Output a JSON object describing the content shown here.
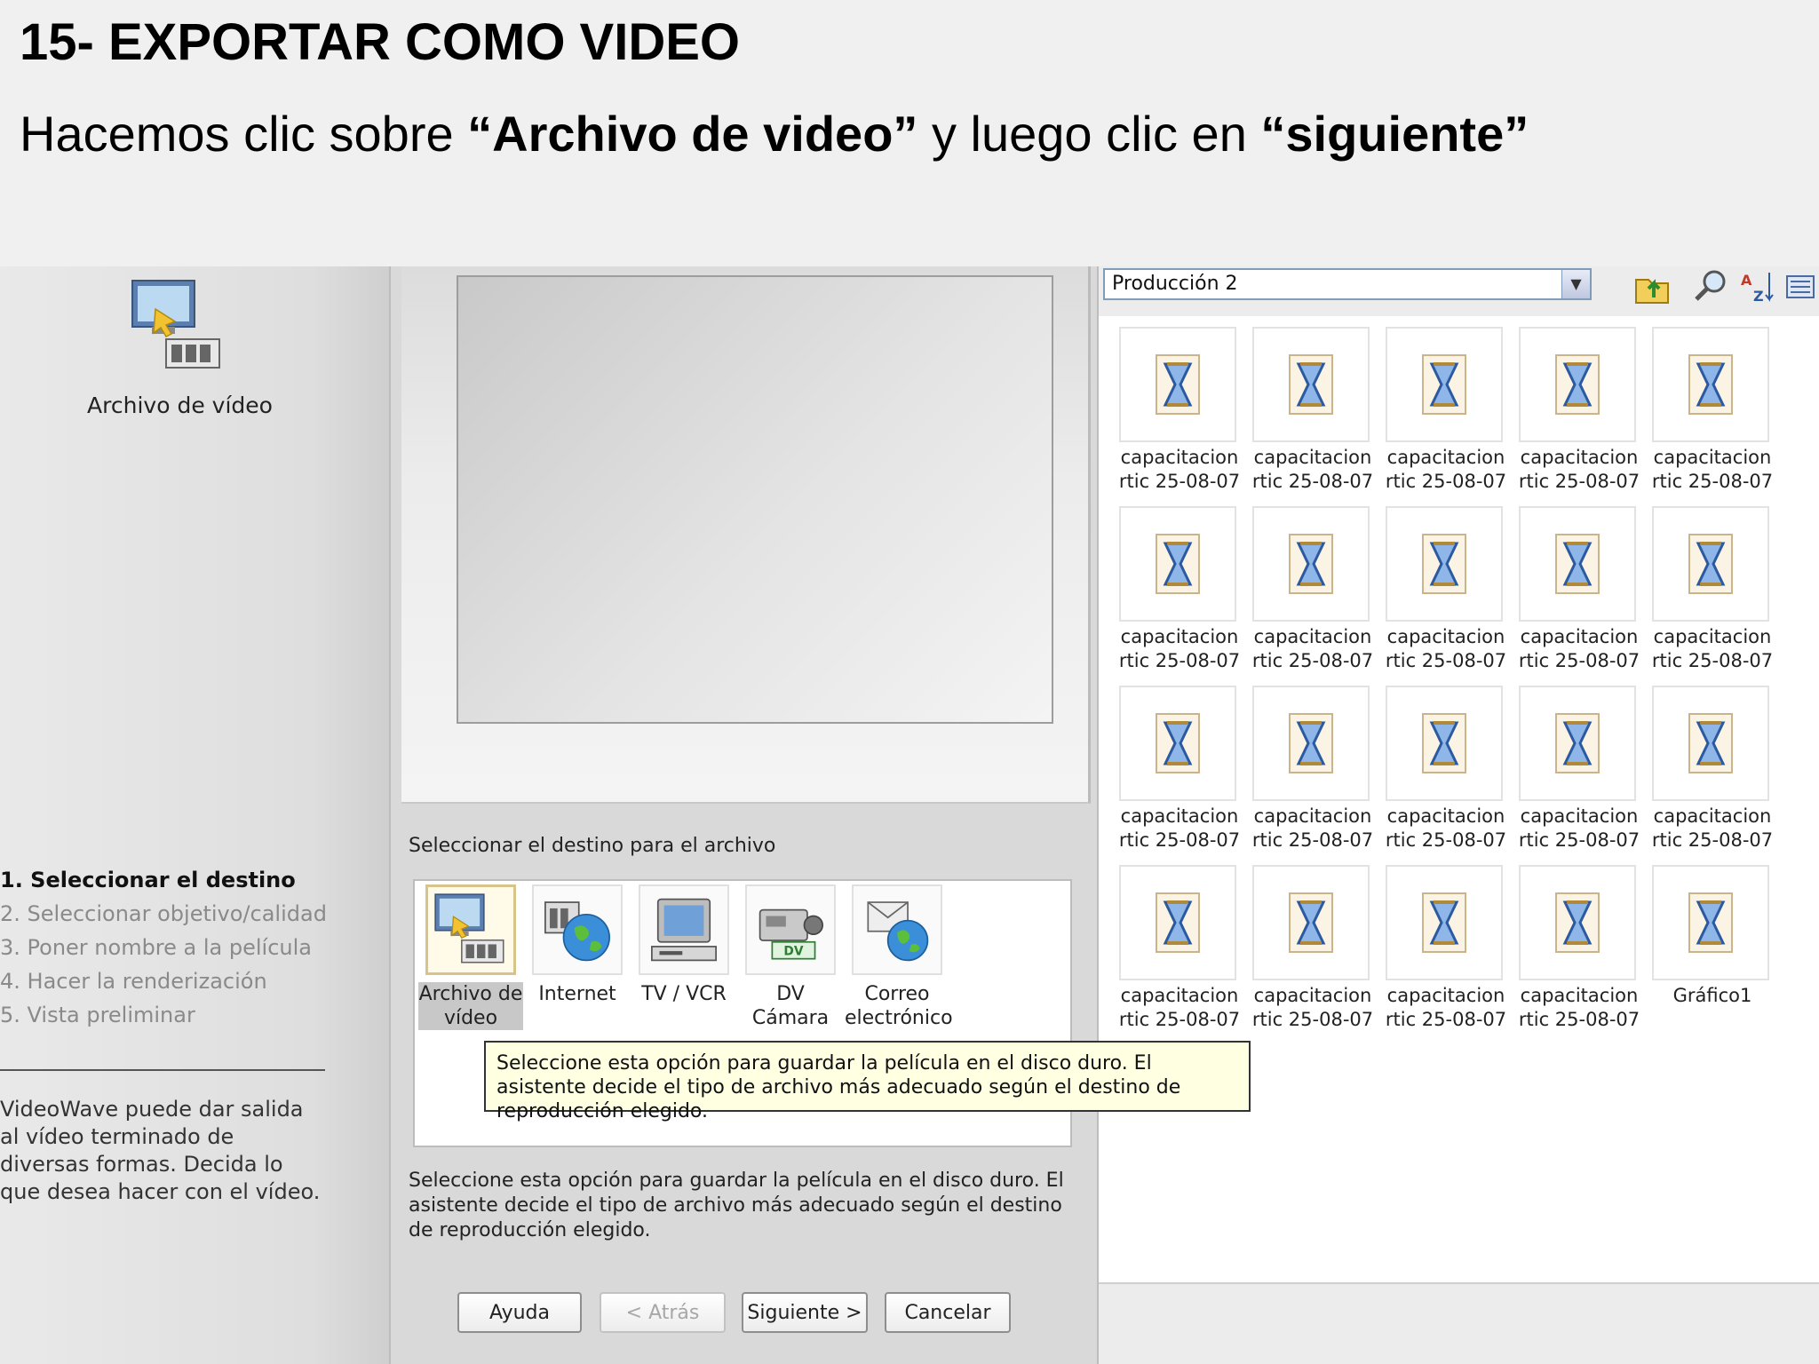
{
  "slide": {
    "title": "15- EXPORTAR COMO VIDEO",
    "subtitle_pre": "Hacemos clic sobre ",
    "subtitle_bold1": "“Archivo de video”",
    "subtitle_mid": " y luego clic en ",
    "subtitle_bold2": "“siguiente”"
  },
  "left_panel": {
    "icon": "video-file-icon",
    "caption": "Archivo de vídeo",
    "steps": [
      "1. Seleccionar el destino",
      "2. Seleccionar objetivo/calidad",
      "3. Poner nombre a la película",
      "4. Hacer la renderización",
      "5. Vista preliminar"
    ],
    "active_step": 0,
    "description": "VideoWave puede dar salida al vídeo terminado de diversas formas. Decida lo que desea hacer con el vídeo."
  },
  "center_panel": {
    "destination_label": "Seleccionar el destino para el archivo",
    "destinations": [
      {
        "line1": "Archivo de",
        "line2": "vídeo",
        "icon": "video-file-icon"
      },
      {
        "line1": "Internet",
        "line2": "",
        "icon": "internet-globe-icon"
      },
      {
        "line1": "TV / VCR",
        "line2": "",
        "icon": "tv-vcr-icon"
      },
      {
        "line1": "DV",
        "line2": "Cámara",
        "icon": "dv-camera-icon"
      },
      {
        "line1": "Correo",
        "line2": "electrónico",
        "icon": "email-icon"
      }
    ],
    "tooltip": "Seleccione esta opción para guardar la película en el disco duro. El asistente decide el tipo de archivo más adecuado según el destino de reproducción elegido.",
    "description": "Seleccione esta opción para guardar la película en el disco duro. El asistente decide el tipo de archivo más adecuado según el destino de reproducción elegido.",
    "buttons": {
      "help": "Ayuda",
      "back": "< Atrás",
      "next": "Siguiente >",
      "cancel": "Cancelar"
    }
  },
  "right_panel": {
    "folder": "Producción 2",
    "toolbar_icons": [
      "folder-up-icon",
      "zoom-search-icon",
      "sort-az-icon",
      "view-mode-icon"
    ],
    "items": [
      {
        "line1": "capacitacion",
        "line2": "rtic 25-08-07"
      },
      {
        "line1": "capacitacion",
        "line2": "rtic 25-08-07"
      },
      {
        "line1": "capacitacion",
        "line2": "rtic 25-08-07"
      },
      {
        "line1": "capacitacion",
        "line2": "rtic 25-08-07"
      },
      {
        "line1": "capacitacion",
        "line2": "rtic 25-08-07"
      },
      {
        "line1": "capacitacion",
        "line2": "rtic 25-08-07"
      },
      {
        "line1": "capacitacion",
        "line2": "rtic 25-08-07"
      },
      {
        "line1": "capacitacion",
        "line2": "rtic 25-08-07"
      },
      {
        "line1": "capacitacion",
        "line2": "rtic 25-08-07"
      },
      {
        "line1": "capacitacion",
        "line2": "rtic 25-08-07"
      },
      {
        "line1": "capacitacion",
        "line2": "rtic 25-08-07"
      },
      {
        "line1": "capacitacion",
        "line2": "rtic 25-08-07"
      },
      {
        "line1": "capacitacion",
        "line2": "rtic 25-08-07"
      },
      {
        "line1": "capacitacion",
        "line2": "rtic 25-08-07"
      },
      {
        "line1": "capacitacion",
        "line2": "rtic 25-08-07"
      },
      {
        "line1": "capacitacion",
        "line2": "rtic 25-08-07"
      },
      {
        "line1": "capacitacion",
        "line2": "rtic 25-08-07"
      },
      {
        "line1": "capacitacion",
        "line2": "rtic 25-08-07"
      },
      {
        "line1": "capacitacion",
        "line2": "rtic 25-08-07"
      },
      {
        "line1": "Gráfico1",
        "line2": ""
      }
    ]
  }
}
